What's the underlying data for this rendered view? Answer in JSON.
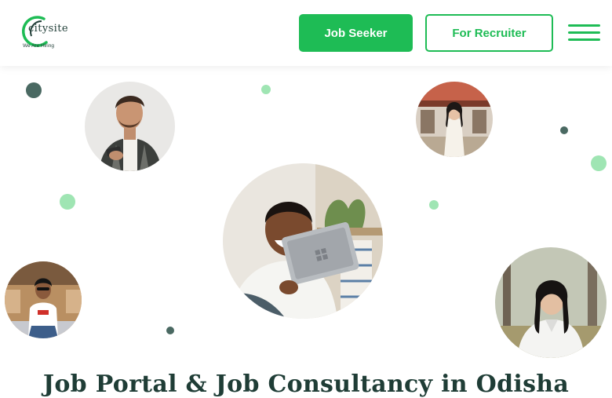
{
  "brand": {
    "name": "citysite",
    "tagline": "We Are Hiring",
    "accent_color": "#1ebc55",
    "dark_color": "#1f3d36"
  },
  "nav": {
    "job_seeker_label": "Job Seeker",
    "recruiter_label": "For Recruiter",
    "menu_icon": "hamburger-menu-icon"
  },
  "hero": {
    "headline": "Job Portal & Job Consultancy in Odisha",
    "photos": [
      "man-with-phone-photo",
      "woman-in-white-dress-photo",
      "smiling-man-with-laptop-photo",
      "man-sitting-outdoors-photo",
      "woman-in-white-shirt-photo"
    ]
  }
}
